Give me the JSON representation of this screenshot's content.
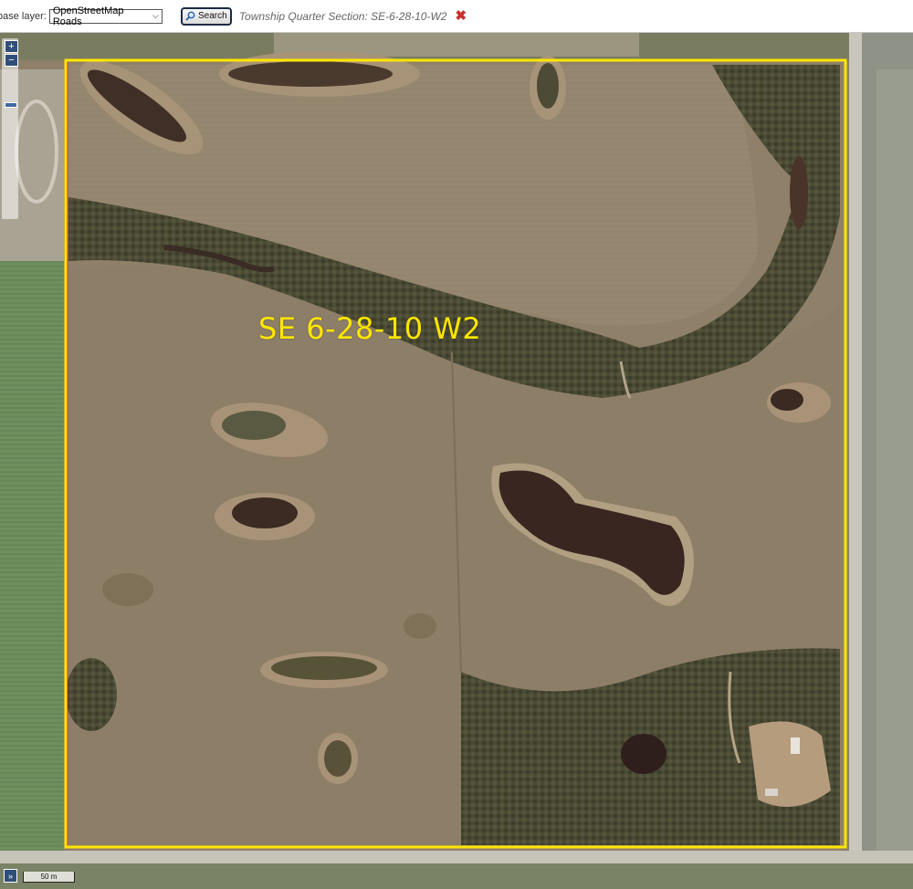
{
  "toolbar": {
    "base_layer_label": "base layer:",
    "base_layer_value": "OpenStreetMap Roads",
    "search_label": "Search",
    "tqs_text": "Township Quarter Section: SE-6-28-10-W2"
  },
  "map": {
    "parcel_label": "SE 6-28-10 W2",
    "zoom_in": "+",
    "zoom_out": "−",
    "expand": "»",
    "scale": "50 m"
  },
  "colors": {
    "parcel_outline": "#ffe600",
    "inner_outline": "#e0202a",
    "label": "#ffe600",
    "control_bg": "#2f4f7a"
  },
  "icons": {
    "search": "magnifier-icon",
    "close": "close-x-icon"
  }
}
